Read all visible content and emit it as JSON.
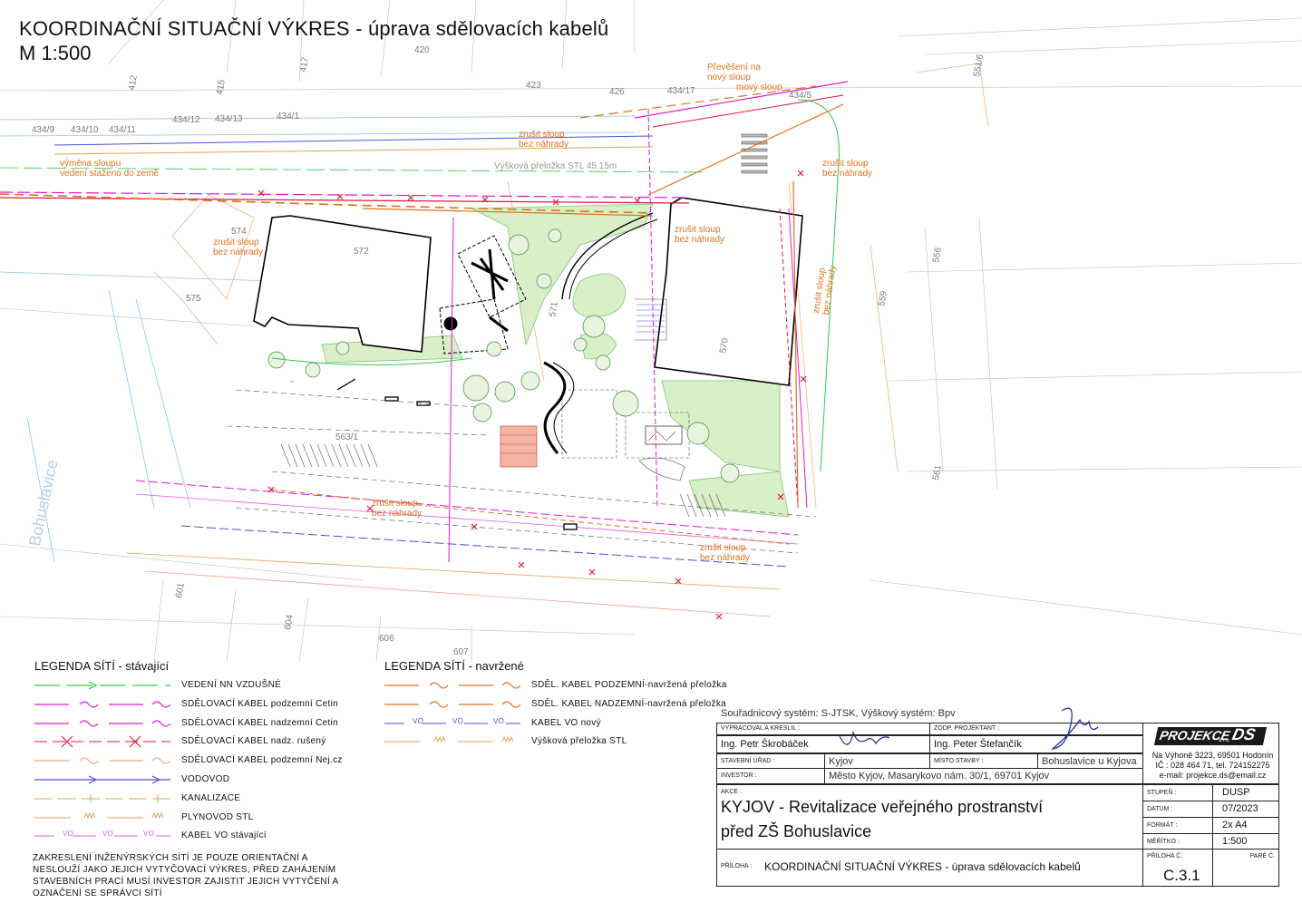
{
  "title": {
    "main": "KOORDINAČNÍ SITUAČNÍ VÝKRES - úprava sdělovacích kabelů",
    "scale": "M 1:500"
  },
  "map": {
    "annotations": [
      "výměna sloupu",
      "vedení staženo do země",
      "zrušit sloup",
      "bez náhrady",
      "Převěšení na",
      "nový sloup",
      "mový sloup",
      "Výšková přeložka STL 45.15m"
    ],
    "parcel_numbers": [
      "412",
      "415",
      "417",
      "420",
      "423",
      "426",
      "434/17",
      "434/5",
      "434/9",
      "434/10",
      "434/11",
      "434/12",
      "434/13",
      "434/1",
      "551/6",
      "572",
      "574",
      "575",
      "570",
      "571",
      "556",
      "559",
      "563/1",
      "561",
      "601",
      "604",
      "606",
      "607"
    ],
    "place_label": "Bohuslavice"
  },
  "legend_existing": {
    "title": "LEGENDA SÍTÍ - stávající",
    "items": [
      {
        "label": "VEDENÍ NN VZDUŠNÉ",
        "color": "#33c94a"
      },
      {
        "label": "SDĚLOVACÍ KABEL podzemní Cetin",
        "color": "#e01ad4"
      },
      {
        "label": "SDĚLOVACÍ KABEL nadzemní Cetin",
        "color": "#e01ad4"
      },
      {
        "label": "SDĚLOVACÍ KABEL nadz. rušený",
        "color": "#e01a3c"
      },
      {
        "label": "SDĚLOVACÍ KABEL podzemní Nej.cz",
        "color": "#f0a58a"
      },
      {
        "label": "VODOVOD",
        "color": "#4f4fe0"
      },
      {
        "label": "KANALIZACE",
        "color": "#e2a35a"
      },
      {
        "label": "PLYNOVOD STL",
        "color": "#e2a35a"
      },
      {
        "label": "KABEL VO stávající",
        "color": "#e45be0"
      }
    ]
  },
  "legend_new": {
    "title": "LEGENDA SÍTÍ - navržené",
    "items": [
      {
        "label": "SDĚL. KABEL PODZEMNÍ-navržená přeložka",
        "color": "#e2711d"
      },
      {
        "label": "SDĚL. KABEL NADZEMNÍ-navržená přeložka",
        "color": "#e2711d"
      },
      {
        "label": "KABEL VO nový",
        "color": "#4f4fe0"
      },
      {
        "label": "Výšková přeložka STL",
        "color": "#e2a35a"
      }
    ],
    "vo_marker": "VO"
  },
  "note": "ZAKRESLENÍ INŽENÝRSKÝCH SÍTÍ JE POUZE ORIENTAČNÍ A NESLOUŽÍ JAKO JEJICH VYTYČOVACÍ VÝKRES, PŘED ZAHÁJENÍM STAVEBNÍCH PRACÍ MUSÍ INVESTOR ZAJISTIT JEJICH VYTYČENÍ A OZNAČENÍ SE SPRÁVCI SÍTÍ",
  "coord_system": "Souřadnicový systém: S-JTSK, Výškový systém: Bpv",
  "titleblock": {
    "vypracoval_label": "VYPRACOVAL A KRESLIL :",
    "vypracoval": "Ing. Petr Škrobáček",
    "zodp_label": "ZODP. PROJEKTANT :",
    "zodp": "Ing. Peter Štefančík",
    "urad_label": "STAVEBNÍ ÚŘAD :",
    "urad": "Kyjov",
    "misto_label": "MÍSTO STAVBY :",
    "misto": "Bohuslavice u Kyjova",
    "investor_label": "INVESTOR :",
    "investor": "Město Kyjov, Masarykovo nám. 30/1, 69701 Kyjov",
    "akce_label": "AKCE :",
    "akce_line1": "KYJOV - Revitalizace veřejného prostranství",
    "akce_line2": "před ZŠ Bohuslavice",
    "priloha_label": "PŘÍLOHA :",
    "priloha": "KOORDINAČNÍ SITUAČNÍ VÝKRES - úprava sdělovacích kabelů",
    "company": "PROJEKCE",
    "company_suffix": "DS",
    "company_sub": "s.r.o.",
    "address1": "Na Výhoně 3223, 69501 Hodonín",
    "address2": "IČ : 028 464 71, tel. 724152275",
    "address3": "e-mail: projekce.ds@email.cz",
    "stupen_label": "STUPEŇ :",
    "stupen": "DUSP",
    "datum_label": "DATUM :",
    "datum": "07/2023",
    "format_label": "FORMÁT :",
    "format": "2x A4",
    "meritko_label": "MĚŘÍTKO :",
    "meritko": "1:500",
    "priloha_c_label": "PŘÍLOHA Č.",
    "priloha_c": "C.3.1",
    "pare_label": "PARÉ Č."
  }
}
